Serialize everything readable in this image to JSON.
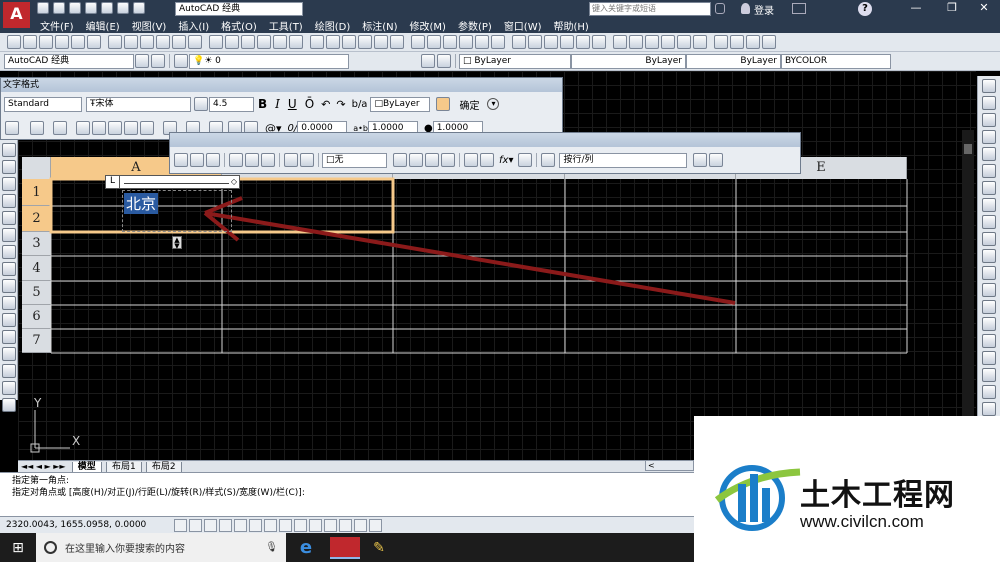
{
  "app": {
    "title": "AutoCAD 经典",
    "search_placeholder": "键入关键字或短语",
    "login": "登录",
    "help": "?"
  },
  "menu": [
    "文件(F)",
    "编辑(E)",
    "视图(V)",
    "插入(I)",
    "格式(O)",
    "工具(T)",
    "绘图(D)",
    "标注(N)",
    "修改(M)",
    "参数(P)",
    "窗口(W)",
    "帮助(H)"
  ],
  "layers": {
    "workspace": "AutoCAD 经典",
    "layer": "0",
    "color": "ByLayer",
    "linetype": "ByLayer",
    "lineweight": "ByLayer",
    "plotstyle": "BYCOLOR"
  },
  "text_format": {
    "title": "文字格式",
    "style": "Standard",
    "font": "宋体",
    "height": "4.5",
    "bold": "B",
    "italic": "I",
    "underline": "U",
    "overline": "Ō",
    "color": "ByLayer",
    "ok": "确定",
    "oblique": "0.0000",
    "tracking": "1.0000",
    "width": "1.0000"
  },
  "table_toolbar": {
    "border": "无",
    "merge": "按行/列"
  },
  "grid": {
    "columns": [
      "A",
      "",
      "",
      "",
      "E"
    ],
    "rows": [
      "1",
      "2",
      "3",
      "4",
      "5",
      "6",
      "7"
    ],
    "cell_text": "北京"
  },
  "ucs": {
    "x": "X",
    "y": "Y"
  },
  "tabs": [
    "模型",
    "布局1",
    "布局2"
  ],
  "command": {
    "line1": "指定第一角点:",
    "line2": "指定对角点或 [高度(H)/对正(J)/行距(L)/旋转(R)/样式(S)/宽度(W)/栏(C)]:"
  },
  "status": {
    "coords": "2320.0043, 1655.0958, 0.0000"
  },
  "taskbar": {
    "search": "在这里输入你要搜索的内容"
  },
  "watermark": {
    "name": "土木工程网",
    "url": "www.civilcn.com"
  },
  "colors": {
    "accent_red": "#c0282d",
    "highlight": "#f6c98a",
    "arrow": "#8b1a1a",
    "titlebar": "#2b3a4e"
  }
}
